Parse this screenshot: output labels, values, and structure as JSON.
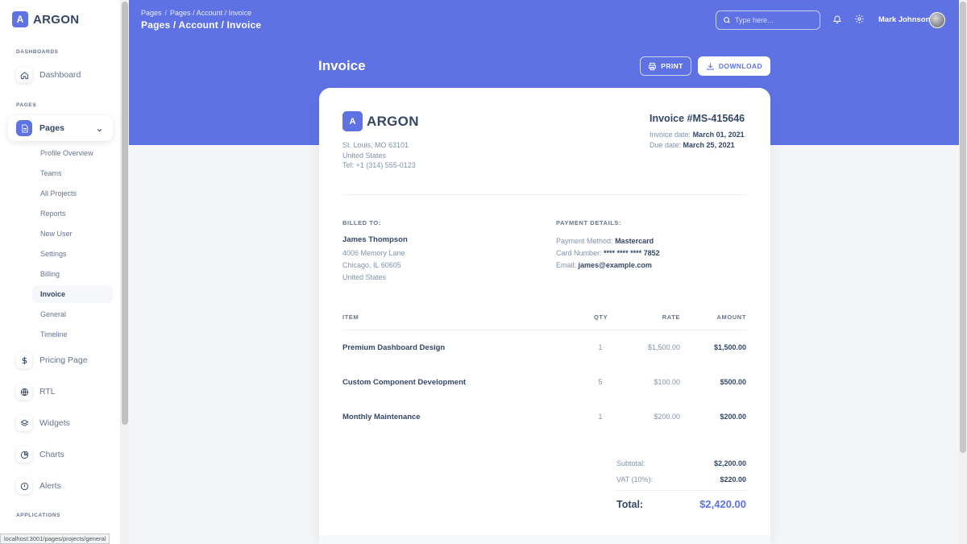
{
  "sidebar": {
    "brand_logo": "A",
    "brand_name": "ARGON",
    "section_dashboards": "DASHBOARDS",
    "section_pages": "PAGES",
    "section_applications": "APPLICATIONS",
    "dashboard_label": "Dashboard",
    "pages_label": "Pages",
    "sub_items": [
      "Profile Overview",
      "Teams",
      "All Projects",
      "Reports",
      "New User",
      "Settings",
      "Billing",
      "Invoice",
      "General",
      "Timeline"
    ],
    "active_sub_item": "Invoice",
    "bottom_items": [
      "Pricing Page",
      "RTL",
      "Widgets",
      "Charts",
      "Alerts"
    ],
    "status_url": "localhost:3001/pages/projects/general"
  },
  "header": {
    "breadcrumb_root": "Pages",
    "breadcrumb_separator": "/",
    "breadcrumb_current": "Pages / Account / Invoice",
    "page_heading": "Pages / Account / Invoice",
    "search_placeholder": "Type here...",
    "user_name": "Mark Johnson"
  },
  "toolbar": {
    "title": "Invoice",
    "print_label": "PRINT",
    "download_label": "DOWNLOAD"
  },
  "invoice": {
    "logo": "A",
    "brand": "ARGON",
    "address_lines": [
      "St. Louis, MO 63101",
      "United States",
      "Tel: +1 (314) 555-0123"
    ],
    "number": "Invoice #MS-415646",
    "invoice_date_label": "Invoice date:",
    "invoice_date": "March 01, 2021",
    "due_date_label": "Due date:",
    "due_date": "March 25, 2021",
    "billed_to_label": "BILLED TO:",
    "billed_name": "James Thompson",
    "billed_address": [
      "4006 Memory Lane",
      "Chicago, IL 60605",
      "United States"
    ],
    "payment_label": "PAYMENT DETAILS:",
    "payment_method_label": "Payment Method:",
    "payment_method": "Mastercard",
    "card_number_label": "Card Number:",
    "card_number": "**** **** **** 7852",
    "email_label": "Email:",
    "email": "james@example.com",
    "columns": {
      "item": "ITEM",
      "qty": "QTY",
      "rate": "RATE",
      "amount": "AMOUNT"
    },
    "items": [
      {
        "name": "Premium Dashboard Design",
        "qty": "1",
        "rate": "$1,500.00",
        "amount": "$1,500.00"
      },
      {
        "name": "Custom Component Development",
        "qty": "5",
        "rate": "$100.00",
        "amount": "$500.00"
      },
      {
        "name": "Monthly Maintenance",
        "qty": "1",
        "rate": "$200.00",
        "amount": "$200.00"
      }
    ],
    "subtotal_label": "Subtotal:",
    "subtotal": "$2,200.00",
    "vat_label": "VAT (10%):",
    "vat": "$220.00",
    "total_label": "Total:",
    "total": "$2,420.00"
  },
  "colors": {
    "accent": "#5e72e4",
    "text_dark": "#344767",
    "text_muted": "#8392ab"
  }
}
